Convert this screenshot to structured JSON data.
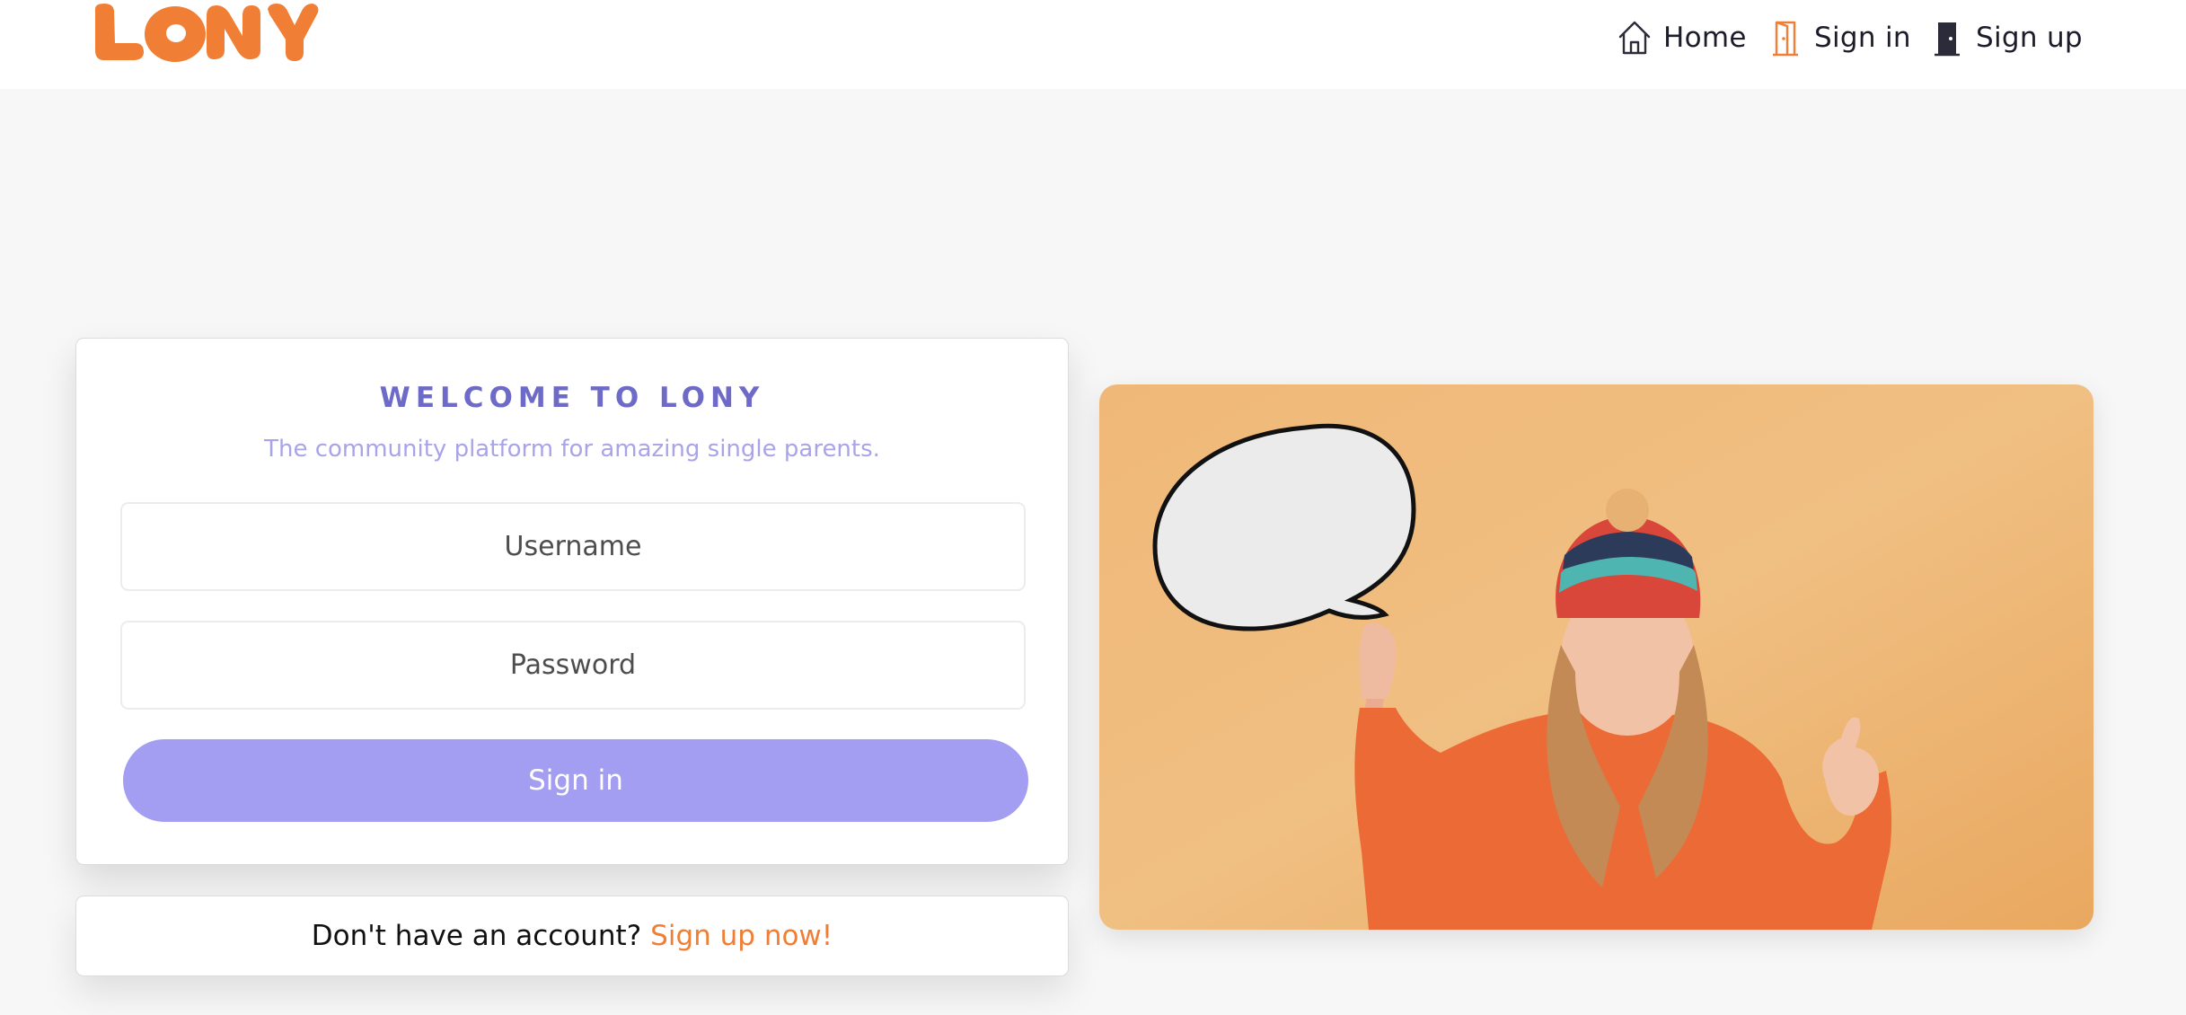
{
  "brand": {
    "name": "LONY",
    "color": "#f07e34"
  },
  "nav": {
    "home": {
      "label": "Home",
      "icon": "home-icon"
    },
    "signin": {
      "label": "Sign in",
      "icon": "door-open-icon"
    },
    "signup": {
      "label": "Sign up",
      "icon": "door-closed-icon"
    }
  },
  "login": {
    "title": "WELCOME TO LONY",
    "subtitle": "The community platform for amazing single parents.",
    "username_placeholder": "Username",
    "password_placeholder": "Password",
    "submit_label": "Sign in"
  },
  "signup_prompt": {
    "text": "Don't have an account?",
    "link": "Sign up now!"
  },
  "colors": {
    "accent_orange": "#f07e34",
    "primary_purple": "#a39ef2",
    "title_purple": "#6e6ac8",
    "background": "#f7f7f7"
  }
}
